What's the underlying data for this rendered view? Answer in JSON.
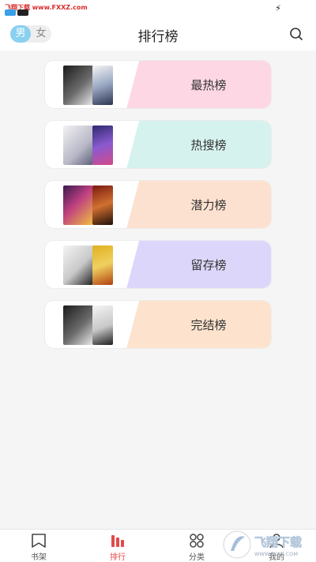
{
  "status_bar": {
    "watermark_text": "飞翔下载 www.FXXZ.com",
    "charging_icon": "lightning-icon"
  },
  "header": {
    "gender": {
      "male_label": "男",
      "female_label": "女",
      "selected": "男"
    },
    "title": "排行榜",
    "search_icon": "search-icon"
  },
  "rankings": [
    {
      "label": "最热榜",
      "accent_color": "#fdd7e3"
    },
    {
      "label": "热搜榜",
      "accent_color": "#d6f2ee"
    },
    {
      "label": "潜力榜",
      "accent_color": "#fde1d0"
    },
    {
      "label": "留存榜",
      "accent_color": "#ddd6fb"
    },
    {
      "label": "完结榜",
      "accent_color": "#fde3cd"
    }
  ],
  "bottom_nav": {
    "items": [
      {
        "label": "书架",
        "icon": "bookmark-icon",
        "active": false
      },
      {
        "label": "排行",
        "icon": "bar-chart-icon",
        "active": true
      },
      {
        "label": "分类",
        "icon": "grid-circles-icon",
        "active": false
      },
      {
        "label": "我的",
        "icon": "profile-icon",
        "active": false
      }
    ],
    "active_color": "#e34a4a"
  },
  "watermark": {
    "text": "飞翔下载",
    "url": "WWW.FXXZ.COM"
  }
}
